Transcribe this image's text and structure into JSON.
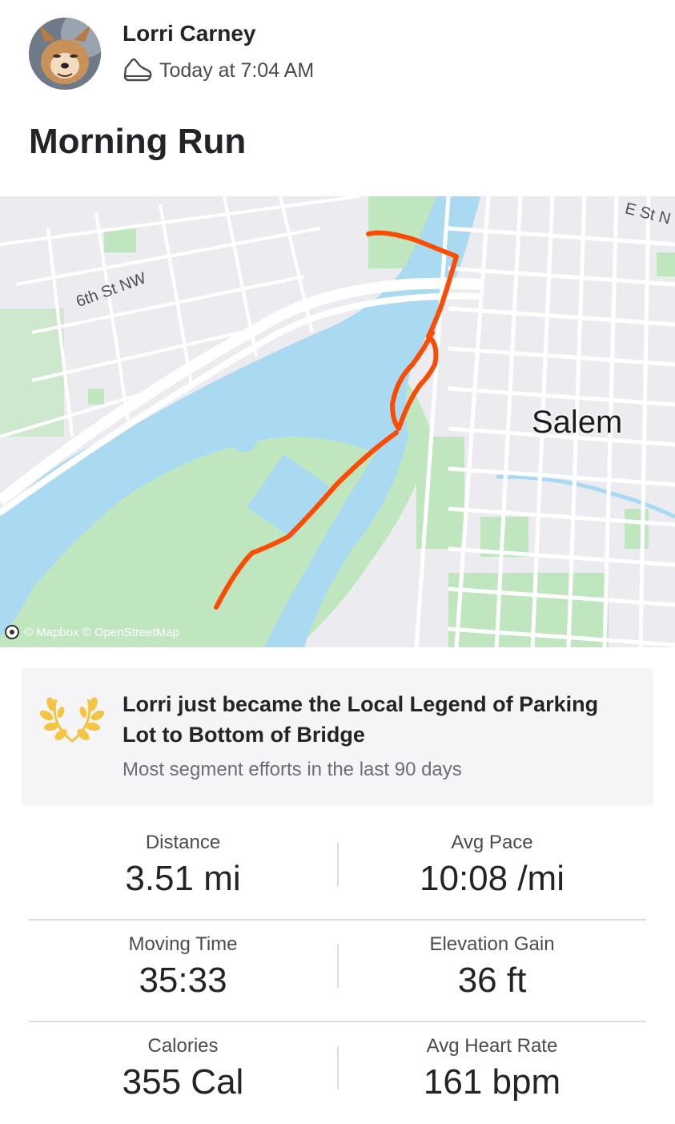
{
  "athlete": {
    "name": "Lorri Carney",
    "time": "Today at 7:04 AM"
  },
  "activity": {
    "title": "Morning Run",
    "type_icon": "shoe-icon"
  },
  "map": {
    "labels": {
      "street_1": "6th St NW",
      "street_2": "E St N",
      "city": "Salem"
    },
    "attribution": "© Mapbox © OpenStreetMap",
    "route_color": "#fc4c02"
  },
  "achievement": {
    "icon": "laurel-icon",
    "title": "Lorri just became the Local Legend of Parking Lot to Bottom of Bridge",
    "subtitle": "Most segment efforts in the last 90 days"
  },
  "stats": [
    {
      "left": {
        "label": "Distance",
        "value": "3.51 mi"
      },
      "right": {
        "label": "Avg Pace",
        "value": "10:08 /mi"
      }
    },
    {
      "left": {
        "label": "Moving Time",
        "value": "35:33"
      },
      "right": {
        "label": "Elevation Gain",
        "value": "36 ft"
      }
    },
    {
      "left": {
        "label": "Calories",
        "value": "355 Cal"
      },
      "right": {
        "label": "Avg Heart Rate",
        "value": "161 bpm"
      }
    }
  ]
}
